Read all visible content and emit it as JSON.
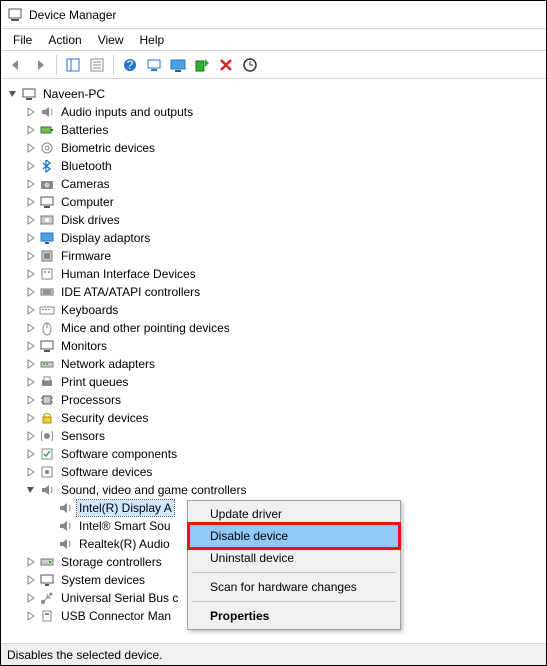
{
  "window": {
    "title": "Device Manager"
  },
  "menubar": [
    "File",
    "Action",
    "View",
    "Help"
  ],
  "toolbar_icons": [
    "back",
    "forward",
    "show-hide",
    "properties",
    "help",
    "update",
    "monitor",
    "enable",
    "disable",
    "scan"
  ],
  "root": {
    "label": "Naveen-PC"
  },
  "categories": [
    {
      "label": "Audio inputs and outputs",
      "icon": "audio"
    },
    {
      "label": "Batteries",
      "icon": "battery"
    },
    {
      "label": "Biometric devices",
      "icon": "biometric"
    },
    {
      "label": "Bluetooth",
      "icon": "bluetooth"
    },
    {
      "label": "Cameras",
      "icon": "camera"
    },
    {
      "label": "Computer",
      "icon": "computer"
    },
    {
      "label": "Disk drives",
      "icon": "disk"
    },
    {
      "label": "Display adaptors",
      "icon": "display"
    },
    {
      "label": "Firmware",
      "icon": "firmware"
    },
    {
      "label": "Human Interface Devices",
      "icon": "hid"
    },
    {
      "label": "IDE ATA/ATAPI controllers",
      "icon": "ide"
    },
    {
      "label": "Keyboards",
      "icon": "keyboard"
    },
    {
      "label": "Mice and other pointing devices",
      "icon": "mouse"
    },
    {
      "label": "Monitors",
      "icon": "monitor"
    },
    {
      "label": "Network adapters",
      "icon": "network"
    },
    {
      "label": "Print queues",
      "icon": "print"
    },
    {
      "label": "Processors",
      "icon": "cpu"
    },
    {
      "label": "Security devices",
      "icon": "security"
    },
    {
      "label": "Sensors",
      "icon": "sensor"
    },
    {
      "label": "Software components",
      "icon": "softcomp"
    },
    {
      "label": "Software devices",
      "icon": "softdev"
    },
    {
      "label": "Sound, video and game controllers",
      "icon": "audio",
      "expanded": true,
      "children": [
        {
          "label": "Intel(R) Display A",
          "selected": true
        },
        {
          "label": "Intel® Smart Sou"
        },
        {
          "label": "Realtek(R) Audio"
        }
      ]
    },
    {
      "label": "Storage controllers",
      "icon": "storage"
    },
    {
      "label": "System devices",
      "icon": "system"
    },
    {
      "label": "Universal Serial Bus c",
      "icon": "usb"
    },
    {
      "label": "USB Connector Man",
      "icon": "usbconn"
    }
  ],
  "context_menu": {
    "items": [
      {
        "label": "Update driver"
      },
      {
        "label": "Disable device",
        "highlight": true
      },
      {
        "label": "Uninstall device"
      },
      {
        "sep": true
      },
      {
        "label": "Scan for hardware changes"
      },
      {
        "sep": true
      },
      {
        "label": "Properties",
        "bold": true
      }
    ]
  },
  "statusbar": "Disables the selected device."
}
